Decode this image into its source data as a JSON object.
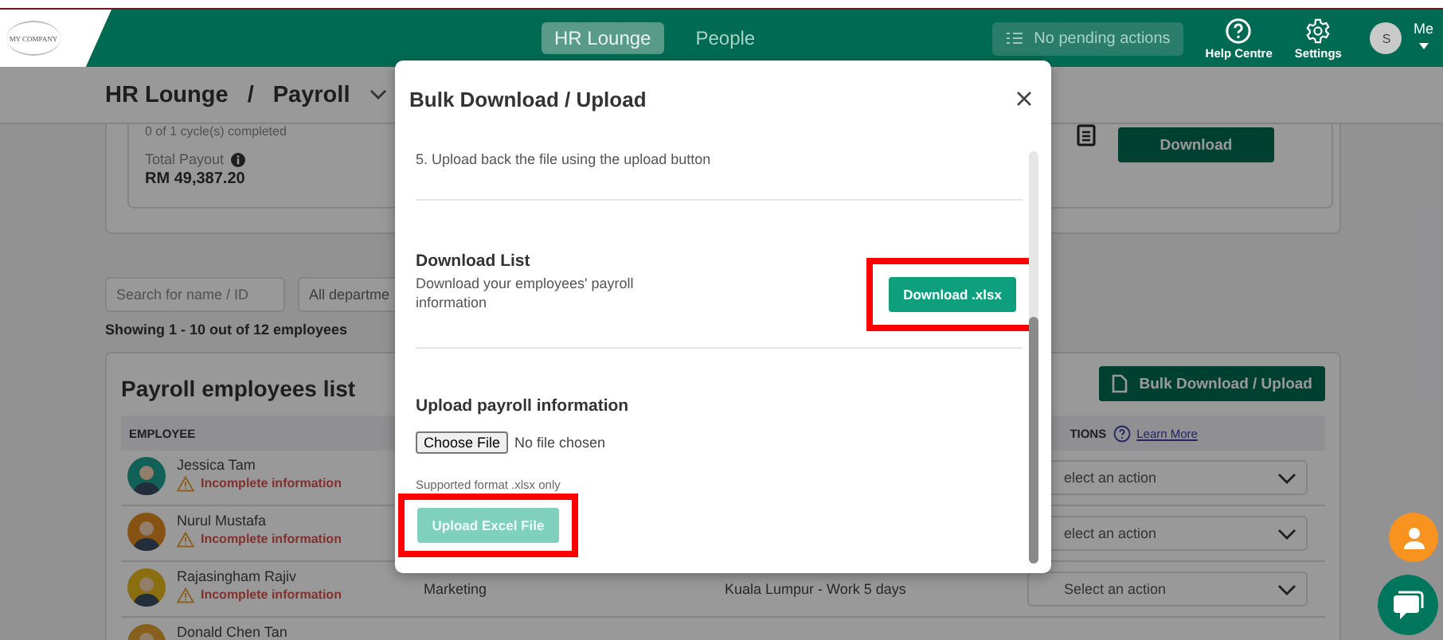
{
  "top_nav": {
    "logo": "MY COMPANY",
    "tabs": [
      {
        "label": "HR Lounge",
        "selected": true
      },
      {
        "label": "People",
        "selected": false
      }
    ],
    "pending": "No pending actions",
    "help": "Help Centre",
    "settings": "Settings",
    "avatar_initial": "S",
    "user": "Me"
  },
  "breadcrumb": {
    "section": "HR Lounge",
    "separator": "/",
    "page": "Payroll"
  },
  "summary_card": {
    "progress": "0 of 1 cycle(s) completed",
    "total_label": "Total Payout",
    "total_value": "RM 49,387.20",
    "download_button": "Download"
  },
  "filters": {
    "search_placeholder": "Search for name / ID",
    "department": "All departme"
  },
  "result_count": "Showing 1 - 10 out of 12 employees",
  "employee_list": {
    "title": "Payroll employees list",
    "bulk_button": "Bulk Download / Upload",
    "columns": [
      "EMPLOYEE",
      "TIONS"
    ],
    "learn_more": "Learn More",
    "rows": [
      {
        "name": "Jessica Tam",
        "warning": "Incomplete information",
        "action": "elect an action"
      },
      {
        "name": "Nurul Mustafa",
        "warning": "Incomplete information",
        "action": "elect an action"
      },
      {
        "name": "Rajasingham Rajiv",
        "warning": "Incomplete information",
        "department": "Marketing",
        "location": "Kuala Lumpur - Work 5 days",
        "action": "Select an action"
      },
      {
        "name": "Donald Chen Tan"
      }
    ]
  },
  "modal": {
    "title": "Bulk Download / Upload",
    "step_text": "5. Upload back the file using the upload button",
    "download_section": {
      "heading": "Download List",
      "description": "Download your employees' payroll information",
      "button": "Download .xlsx",
      "highlighted": true
    },
    "upload_section": {
      "heading": "Upload payroll information",
      "file_button": "Choose File",
      "file_status": "No file chosen",
      "hint": "Supported format .xlsx only",
      "button": "Upload Excel File",
      "disabled": true,
      "highlighted": true
    }
  }
}
